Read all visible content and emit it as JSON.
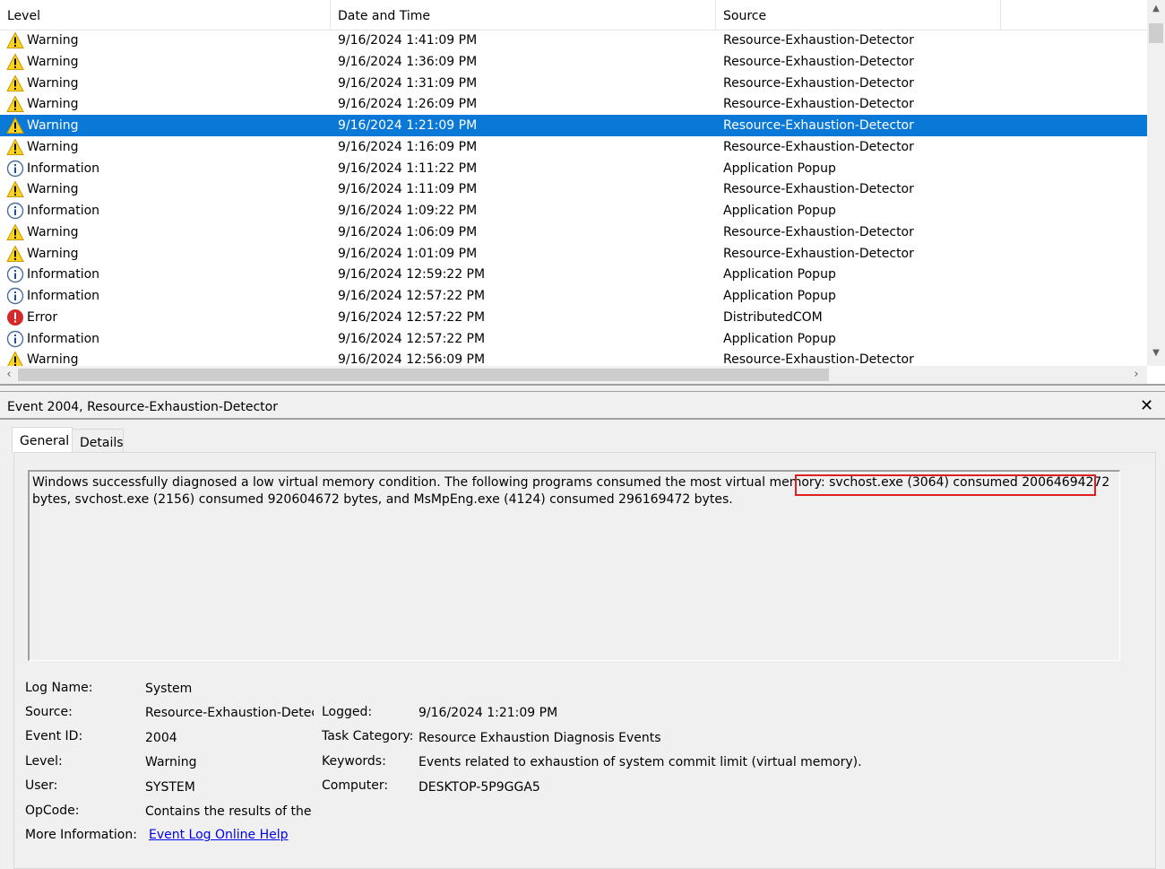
{
  "columns": {
    "level": "Level",
    "date": "Date and Time",
    "source": "Source"
  },
  "events": [
    {
      "level": "Warning",
      "icon": "warning-icon",
      "date": "9/16/2024 1:41:09 PM",
      "source": "Resource-Exhaustion-Detector"
    },
    {
      "level": "Warning",
      "icon": "warning-icon",
      "date": "9/16/2024 1:36:09 PM",
      "source": "Resource-Exhaustion-Detector"
    },
    {
      "level": "Warning",
      "icon": "warning-icon",
      "date": "9/16/2024 1:31:09 PM",
      "source": "Resource-Exhaustion-Detector"
    },
    {
      "level": "Warning",
      "icon": "warning-icon",
      "date": "9/16/2024 1:26:09 PM",
      "source": "Resource-Exhaustion-Detector"
    },
    {
      "level": "Warning",
      "icon": "warning-icon",
      "date": "9/16/2024 1:21:09 PM",
      "source": "Resource-Exhaustion-Detector",
      "selected": true
    },
    {
      "level": "Warning",
      "icon": "warning-icon",
      "date": "9/16/2024 1:16:09 PM",
      "source": "Resource-Exhaustion-Detector"
    },
    {
      "level": "Information",
      "icon": "info-icon",
      "date": "9/16/2024 1:11:22 PM",
      "source": "Application Popup"
    },
    {
      "level": "Warning",
      "icon": "warning-icon",
      "date": "9/16/2024 1:11:09 PM",
      "source": "Resource-Exhaustion-Detector"
    },
    {
      "level": "Information",
      "icon": "info-icon",
      "date": "9/16/2024 1:09:22 PM",
      "source": "Application Popup"
    },
    {
      "level": "Warning",
      "icon": "warning-icon",
      "date": "9/16/2024 1:06:09 PM",
      "source": "Resource-Exhaustion-Detector"
    },
    {
      "level": "Warning",
      "icon": "warning-icon",
      "date": "9/16/2024 1:01:09 PM",
      "source": "Resource-Exhaustion-Detector"
    },
    {
      "level": "Information",
      "icon": "info-icon",
      "date": "9/16/2024 12:59:22 PM",
      "source": "Application Popup"
    },
    {
      "level": "Information",
      "icon": "info-icon",
      "date": "9/16/2024 12:57:22 PM",
      "source": "Application Popup"
    },
    {
      "level": "Error",
      "icon": "error-icon",
      "date": "9/16/2024 12:57:22 PM",
      "source": "DistributedCOM"
    },
    {
      "level": "Information",
      "icon": "info-icon",
      "date": "9/16/2024 12:57:22 PM",
      "source": "Application Popup"
    },
    {
      "level": "Warning",
      "icon": "warning-icon",
      "date": "9/16/2024 12:56:09 PM",
      "source": "Resource-Exhaustion-Detector"
    }
  ],
  "detail": {
    "title": "Event 2004, Resource-Exhaustion-Detector",
    "tabs": {
      "general": "General",
      "details": "Details"
    },
    "description_part1": "Windows successfully diagnosed a low virtual memory condition. The following programs consumed the most virtual memory:",
    "description_highlight": "svchost.exe (3064) consumed 20064694272 bytes,",
    "description_part2": "svchost.exe (2156) consumed 920604672 bytes, and MsMpEng.exe (4124) consumed 296169472 bytes.",
    "fields": {
      "log_name_label": "Log Name:",
      "log_name": "System",
      "source_label": "Source:",
      "source": "Resource-Exhaustion-Detecto",
      "event_id_label": "Event ID:",
      "event_id": "2004",
      "level_label": "Level:",
      "level": "Warning",
      "user_label": "User:",
      "user": "SYSTEM",
      "opcode_label": "OpCode:",
      "opcode": "Contains the results of the di",
      "more_info_label": "More Information:",
      "more_info_link": "Event Log Online Help",
      "logged_label": "Logged:",
      "logged": "9/16/2024 1:21:09 PM",
      "task_category_label": "Task Category:",
      "task_category": "Resource Exhaustion Diagnosis Events",
      "keywords_label": "Keywords:",
      "keywords": "Events related to exhaustion of system commit limit (virtual memory).",
      "computer_label": "Computer:",
      "computer": "DESKTOP-5P9GGA5"
    }
  },
  "colors": {
    "selection": "#0a78d7",
    "highlight_border": "#e02020",
    "link": "#0000ee"
  }
}
